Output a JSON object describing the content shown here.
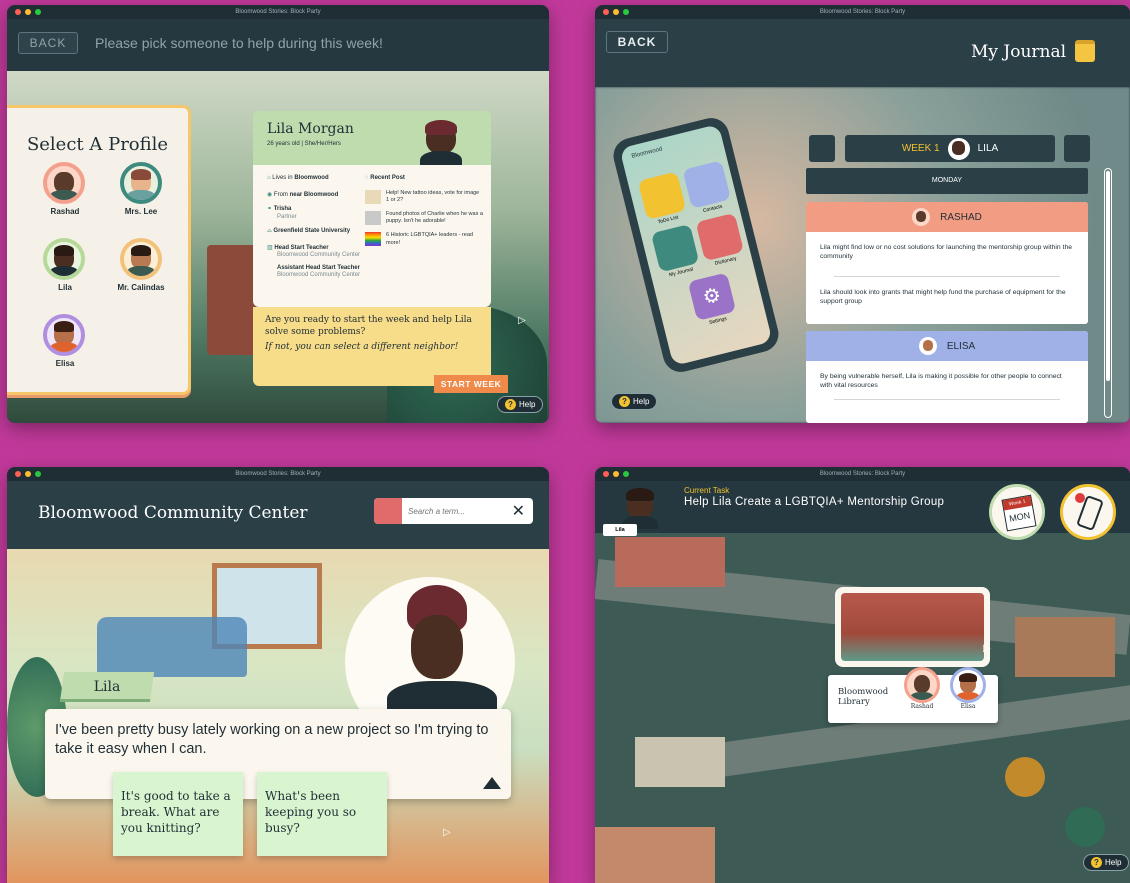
{
  "app_title": "Bloomwood Stories: Block Party",
  "colors": {
    "background": "#c0399a",
    "header": "#2b3f47",
    "accent": "#f08a4b",
    "note_green": "#d9f5cf"
  },
  "w1": {
    "back": "BACK",
    "prompt": "Please pick someone to help during this week!",
    "select_title": "Select A Profile",
    "profiles": [
      {
        "name": "Rashad",
        "ring": "#f3a18c"
      },
      {
        "name": "Mrs. Lee",
        "ring": "#3f8a7e"
      },
      {
        "name": "Lila",
        "ring": "#b6d99a"
      },
      {
        "name": "Mr. Calindas",
        "ring": "#f2c27a"
      },
      {
        "name": "Elisa",
        "ring": "#b08ee0"
      }
    ],
    "card": {
      "name": "Lila Morgan",
      "meta": "26 years old  |  She/Her/Hers",
      "lives_prefix": "Lives in ",
      "lives": "Bloomwood",
      "from_prefix": "From ",
      "from": "near Bloomwood",
      "partner_name": "Trisha",
      "partner_label": "Partner",
      "school": "Greenfield State University",
      "job1": "Head Start Teacher",
      "job1_org": "Bloomwood Community Center",
      "job2": "Assistant Head Start Teacher",
      "job2_org": "Bloomwood Community Center",
      "recent_post": "Recent Post",
      "posts": [
        "Help! New tattoo ideas, vote for image 1 or 2?",
        "Found photos of Charlie when he was a puppy. Isn't he adorable!",
        "6 Historic LGBTQIA+ leaders - read more!"
      ]
    },
    "ready_q": "Are you ready to start the week and help Lila solve some problems?",
    "ready_alt": "If not, you can select a different neighbor!",
    "start": "START WEEK",
    "help": "Help"
  },
  "w2": {
    "back": "BACK",
    "title": "My Journal",
    "phone_apps": [
      "ToDo List",
      "Contacts",
      "My Journal",
      "Dictionary",
      "Settings"
    ],
    "phone_location": "Bloomwood",
    "week": "WEEK 1",
    "person": "LILA",
    "day": "MONDAY",
    "entries": [
      {
        "name": "RASHAD",
        "color": "#f39c84",
        "notes": [
          "Lila might find low or no cost solutions for launching the mentorship group within the community",
          "Lila should look into grants that might help fund the purchase of equipment for the support group"
        ]
      },
      {
        "name": "ELISA",
        "color": "#9fb1e6",
        "notes": [
          "By being vulnerable herself, Lila is making it possible for other people to connect with vital resources"
        ]
      }
    ],
    "help": "Help"
  },
  "w3": {
    "title": "Bloomwood Community Center",
    "search_placeholder": "Search a term...",
    "speaker": "Lila",
    "dialog": "I've been pretty busy lately working on a new project so I'm trying to take it easy when I can.",
    "choices": [
      "It's good to take a break. What are you knitting?",
      "What's been keeping you so busy?"
    ]
  },
  "w4": {
    "task_label": "Current Task",
    "task": "Help Lila Create a LGBTQIA+ Mentorship Group",
    "player": "Lila",
    "cal_week": "Week 1",
    "cal_day": "MON",
    "location": "Bloomwood Library",
    "people": [
      "Rashad",
      "Elisa"
    ],
    "help": "Help"
  }
}
